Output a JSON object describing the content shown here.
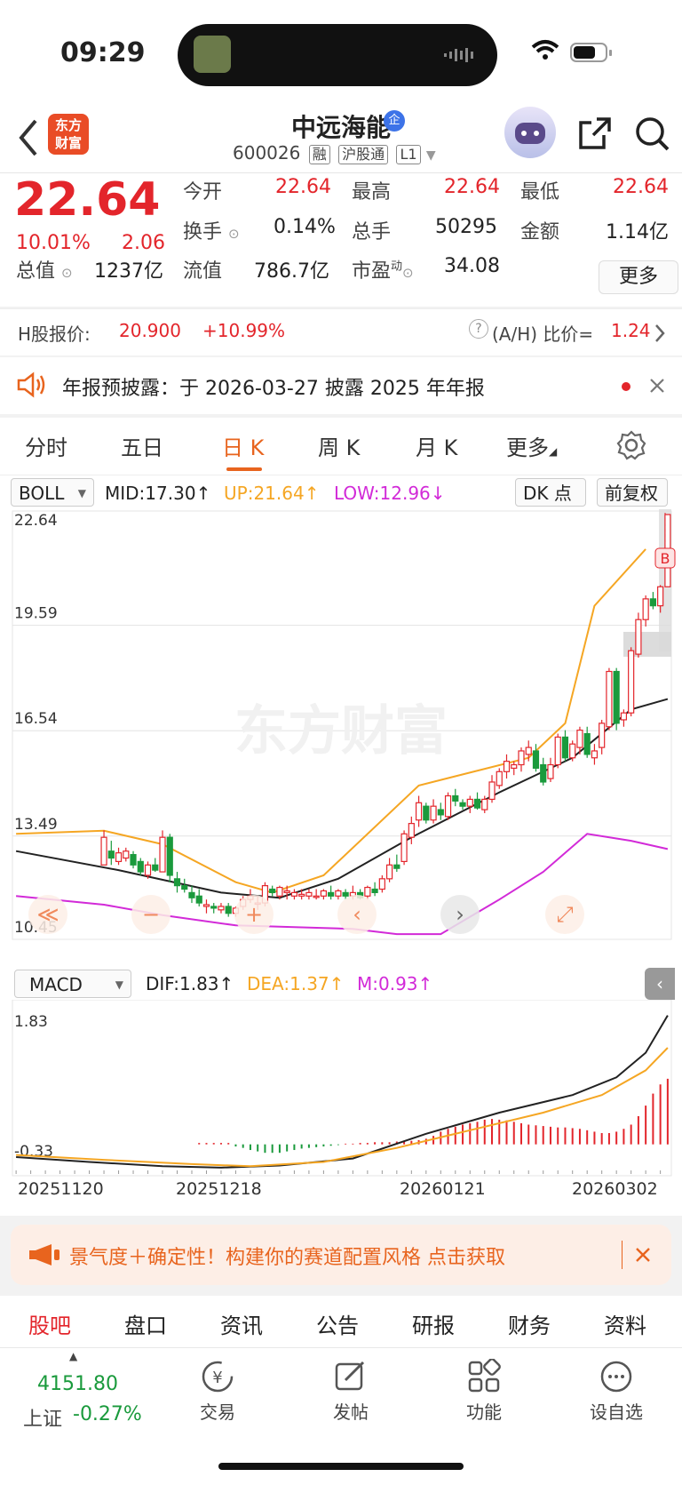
{
  "status_bar": {
    "time": "09:29"
  },
  "header": {
    "brand": [
      "东方",
      "财富"
    ],
    "stock_name": "中远海能",
    "badge": "企",
    "code": "600026",
    "tags": [
      "融",
      "沪股通",
      "L1"
    ]
  },
  "quote": {
    "price": "22.64",
    "pct_change": "10.01%",
    "change": "2.06",
    "fields": [
      {
        "label": "今开",
        "value": "22.64"
      },
      {
        "label": "最高",
        "value": "22.64"
      },
      {
        "label": "最低",
        "value": "22.64"
      },
      {
        "label": "换手",
        "value": "0.14%"
      },
      {
        "label": "总手",
        "value": "50295"
      },
      {
        "label": "金额",
        "value": "1.14亿"
      },
      {
        "label": "总值",
        "value": "1237亿"
      },
      {
        "label": "流值",
        "value": "786.7亿"
      },
      {
        "label": "市盈",
        "label_sup": "动",
        "value": "34.08"
      }
    ],
    "more_label": "更多"
  },
  "hk": {
    "label": "H股报价:",
    "price": "20.900",
    "pct": "+10.99%",
    "ratio_label": "(A/H) 比价=",
    "ratio": "1.24"
  },
  "notice": {
    "text": "年报预披露：于 2026-03-27 披露 2025 年年报"
  },
  "tabs": [
    "分时",
    "五日",
    "日 K",
    "周 K",
    "月 K",
    "更多"
  ],
  "active_tab": 2,
  "kline": {
    "indicator": "BOLL",
    "mid": "MID:17.30",
    "up": "UP:21.64",
    "low": "LOW:12.96",
    "dk_label": "DK 点",
    "adjust_label": "前复权",
    "y_labels": [
      "22.64",
      "19.59",
      "16.54",
      "13.49",
      "10.45"
    ],
    "b_marker": "B",
    "watermark": "东方财富"
  },
  "macd": {
    "indicator": "MACD",
    "dif": "DIF:1.83",
    "dea": "DEA:1.37",
    "m": "M:0.93",
    "y_labels": [
      "1.83",
      "-0.33"
    ],
    "dates": [
      "20251120",
      "20251218",
      "20260121",
      "20260302"
    ]
  },
  "chart_data": {
    "type": "candlestick",
    "y_range": [
      10.45,
      22.64
    ],
    "x_ticks": [
      "20251120",
      "20251218",
      "20260121",
      "20260302"
    ],
    "candles": [
      [
        12.5,
        13.5,
        12.7,
        13.3
      ],
      [
        12.9,
        13.2,
        12.5,
        12.7
      ],
      [
        12.6,
        13.0,
        12.5,
        12.85
      ],
      [
        12.7,
        13.0,
        12.6,
        12.9
      ],
      [
        12.8,
        12.9,
        12.4,
        12.5
      ],
      [
        12.6,
        12.7,
        12.2,
        12.3
      ],
      [
        12.2,
        12.6,
        12.1,
        12.5
      ],
      [
        12.5,
        12.7,
        12.3,
        12.35
      ],
      [
        12.3,
        13.5,
        12.3,
        13.3
      ],
      [
        13.3,
        13.4,
        12.0,
        12.2
      ],
      [
        12.1,
        12.3,
        11.7,
        11.9
      ],
      [
        11.9,
        12.1,
        11.7,
        11.8
      ],
      [
        11.7,
        11.9,
        11.4,
        11.55
      ],
      [
        11.6,
        11.8,
        11.3,
        11.4
      ],
      [
        11.3,
        11.5,
        11.1,
        11.35
      ],
      [
        11.3,
        11.4,
        11.1,
        11.25
      ],
      [
        11.2,
        11.4,
        11.1,
        11.3
      ],
      [
        11.3,
        11.4,
        11.0,
        11.1
      ],
      [
        11.1,
        11.3,
        11.0,
        11.25
      ],
      [
        11.3,
        11.6,
        11.2,
        11.5
      ],
      [
        11.5,
        11.8,
        11.4,
        11.6
      ],
      [
        11.4,
        11.6,
        11.2,
        11.4
      ],
      [
        11.4,
        12.0,
        11.3,
        11.9
      ],
      [
        11.8,
        11.9,
        11.6,
        11.7
      ],
      [
        11.6,
        11.9,
        11.5,
        11.85
      ],
      [
        11.7,
        11.9,
        11.5,
        11.75
      ],
      [
        11.6,
        11.8,
        11.5,
        11.7
      ],
      [
        11.6,
        11.8,
        11.5,
        11.65
      ],
      [
        11.6,
        11.8,
        11.5,
        11.7
      ],
      [
        11.6,
        11.8,
        11.5,
        11.6
      ],
      [
        11.6,
        11.8,
        11.5,
        11.75
      ],
      [
        11.7,
        11.9,
        11.5,
        11.6
      ],
      [
        11.6,
        11.8,
        11.5,
        11.75
      ],
      [
        11.7,
        11.8,
        11.5,
        11.6
      ],
      [
        11.6,
        11.9,
        11.5,
        11.7
      ],
      [
        11.7,
        11.8,
        11.5,
        11.55
      ],
      [
        11.6,
        11.9,
        11.5,
        11.85
      ],
      [
        11.8,
        12.0,
        11.6,
        11.7
      ],
      [
        11.8,
        12.2,
        11.7,
        12.1
      ],
      [
        12.1,
        12.7,
        12.0,
        12.5
      ],
      [
        12.5,
        12.8,
        12.3,
        12.4
      ],
      [
        12.6,
        13.5,
        12.5,
        13.4
      ],
      [
        13.3,
        13.9,
        13.1,
        13.7
      ],
      [
        13.8,
        14.5,
        13.6,
        14.3
      ],
      [
        14.2,
        14.3,
        13.7,
        13.8
      ],
      [
        13.8,
        14.4,
        13.7,
        14.2
      ],
      [
        14.1,
        14.3,
        13.8,
        13.95
      ],
      [
        13.9,
        14.6,
        13.8,
        14.5
      ],
      [
        14.5,
        14.7,
        14.2,
        14.35
      ],
      [
        14.3,
        14.4,
        14.1,
        14.2
      ],
      [
        14.2,
        14.5,
        14.0,
        14.4
      ],
      [
        14.4,
        14.6,
        14.1,
        14.15
      ],
      [
        14.1,
        14.5,
        14.0,
        14.4
      ],
      [
        14.4,
        15.1,
        14.3,
        14.9
      ],
      [
        14.8,
        15.3,
        14.7,
        15.2
      ],
      [
        15.2,
        15.7,
        15.0,
        15.5
      ],
      [
        15.3,
        15.5,
        15.1,
        15.4
      ],
      [
        15.4,
        15.9,
        15.2,
        15.8
      ],
      [
        15.7,
        16.1,
        15.5,
        15.9
      ],
      [
        15.8,
        16.0,
        15.2,
        15.3
      ],
      [
        15.4,
        15.6,
        14.8,
        14.9
      ],
      [
        15.0,
        15.6,
        14.9,
        15.4
      ],
      [
        15.4,
        16.3,
        15.3,
        16.2
      ],
      [
        16.2,
        16.4,
        15.5,
        15.6
      ],
      [
        15.6,
        16.1,
        15.5,
        16.0
      ],
      [
        15.9,
        16.5,
        15.7,
        16.4
      ],
      [
        16.3,
        16.5,
        15.6,
        15.7
      ],
      [
        15.6,
        16.0,
        15.4,
        15.8
      ],
      [
        15.9,
        16.7,
        15.7,
        16.6
      ],
      [
        16.5,
        18.2,
        16.4,
        18.1
      ],
      [
        18.1,
        18.2,
        16.4,
        16.6
      ],
      [
        16.7,
        17.0,
        16.5,
        16.9
      ],
      [
        16.9,
        18.8,
        16.8,
        18.7
      ],
      [
        18.6,
        19.8,
        18.5,
        19.6
      ],
      [
        19.6,
        20.3,
        19.4,
        20.2
      ],
      [
        20.2,
        20.4,
        19.9,
        20.0
      ],
      [
        20.0,
        20.6,
        19.8,
        20.55
      ],
      [
        20.55,
        22.64,
        20.55,
        22.64
      ]
    ],
    "boll_up": [
      [
        0,
        13.4
      ],
      [
        12,
        13.49
      ],
      [
        20,
        13.1
      ],
      [
        30,
        12.0
      ],
      [
        35,
        11.7
      ],
      [
        42,
        12.2
      ],
      [
        55,
        14.8
      ],
      [
        70,
        15.6
      ],
      [
        75,
        16.6
      ],
      [
        79,
        20.0
      ],
      [
        86,
        21.64
      ]
    ],
    "boll_mid": [
      [
        0,
        12.9
      ],
      [
        14,
        12.35
      ],
      [
        28,
        11.7
      ],
      [
        36,
        11.55
      ],
      [
        44,
        12.1
      ],
      [
        54,
        13.3
      ],
      [
        66,
        14.6
      ],
      [
        76,
        15.6
      ],
      [
        84,
        17.0
      ],
      [
        89,
        17.3
      ]
    ],
    "boll_low": [
      [
        0,
        11.6
      ],
      [
        12,
        11.35
      ],
      [
        20,
        11.05
      ],
      [
        30,
        10.75
      ],
      [
        38,
        10.7
      ],
      [
        46,
        10.65
      ],
      [
        52,
        10.5
      ],
      [
        58,
        10.5
      ],
      [
        66,
        11.5
      ],
      [
        72,
        12.3
      ],
      [
        78,
        13.4
      ],
      [
        84,
        13.2
      ],
      [
        89,
        12.96
      ]
    ],
    "macd_dif": [
      [
        0,
        -0.18
      ],
      [
        10,
        -0.25
      ],
      [
        20,
        -0.31
      ],
      [
        28,
        -0.33
      ],
      [
        36,
        -0.3
      ],
      [
        46,
        -0.2
      ],
      [
        56,
        0.15
      ],
      [
        66,
        0.45
      ],
      [
        76,
        0.7
      ],
      [
        82,
        0.95
      ],
      [
        86,
        1.3
      ],
      [
        89,
        1.83
      ]
    ],
    "macd_dea": [
      [
        0,
        -0.15
      ],
      [
        12,
        -0.22
      ],
      [
        24,
        -0.28
      ],
      [
        32,
        -0.31
      ],
      [
        42,
        -0.25
      ],
      [
        52,
        -0.05
      ],
      [
        62,
        0.2
      ],
      [
        72,
        0.45
      ],
      [
        80,
        0.7
      ],
      [
        86,
        1.05
      ],
      [
        89,
        1.37
      ]
    ],
    "macd_hist": [
      0.02,
      0.02,
      0.02,
      0.02,
      0.02,
      -0.03,
      -0.05,
      -0.08,
      -0.1,
      -0.12,
      -0.12,
      -0.12,
      -0.1,
      -0.08,
      -0.06,
      -0.05,
      -0.04,
      -0.03,
      -0.02,
      -0.01,
      0.01,
      0.01,
      0.02,
      0.02,
      0.03,
      0.03,
      0.03,
      0.04,
      0.04,
      0.05,
      0.06,
      0.08,
      0.12,
      0.18,
      0.22,
      0.25,
      0.28,
      0.3,
      0.32,
      0.35,
      0.36,
      0.35,
      0.34,
      0.32,
      0.3,
      0.28,
      0.27,
      0.26,
      0.25,
      0.24,
      0.24,
      0.23,
      0.22,
      0.2,
      0.18,
      0.16,
      0.16,
      0.18,
      0.22,
      0.28,
      0.4,
      0.55,
      0.72,
      0.85,
      0.93
    ]
  },
  "banner": {
    "text": "景气度＋确定性！构建你的赛道配置风格 点击获取"
  },
  "subtabs": [
    "股吧",
    "盘口",
    "资讯",
    "公告",
    "研报",
    "财务",
    "资料"
  ],
  "bottom_nav": {
    "index_value": "4151.80",
    "index_name": "上证",
    "index_pct": "-0.27%",
    "items": [
      "交易",
      "发帖",
      "功能",
      "设自选"
    ]
  }
}
